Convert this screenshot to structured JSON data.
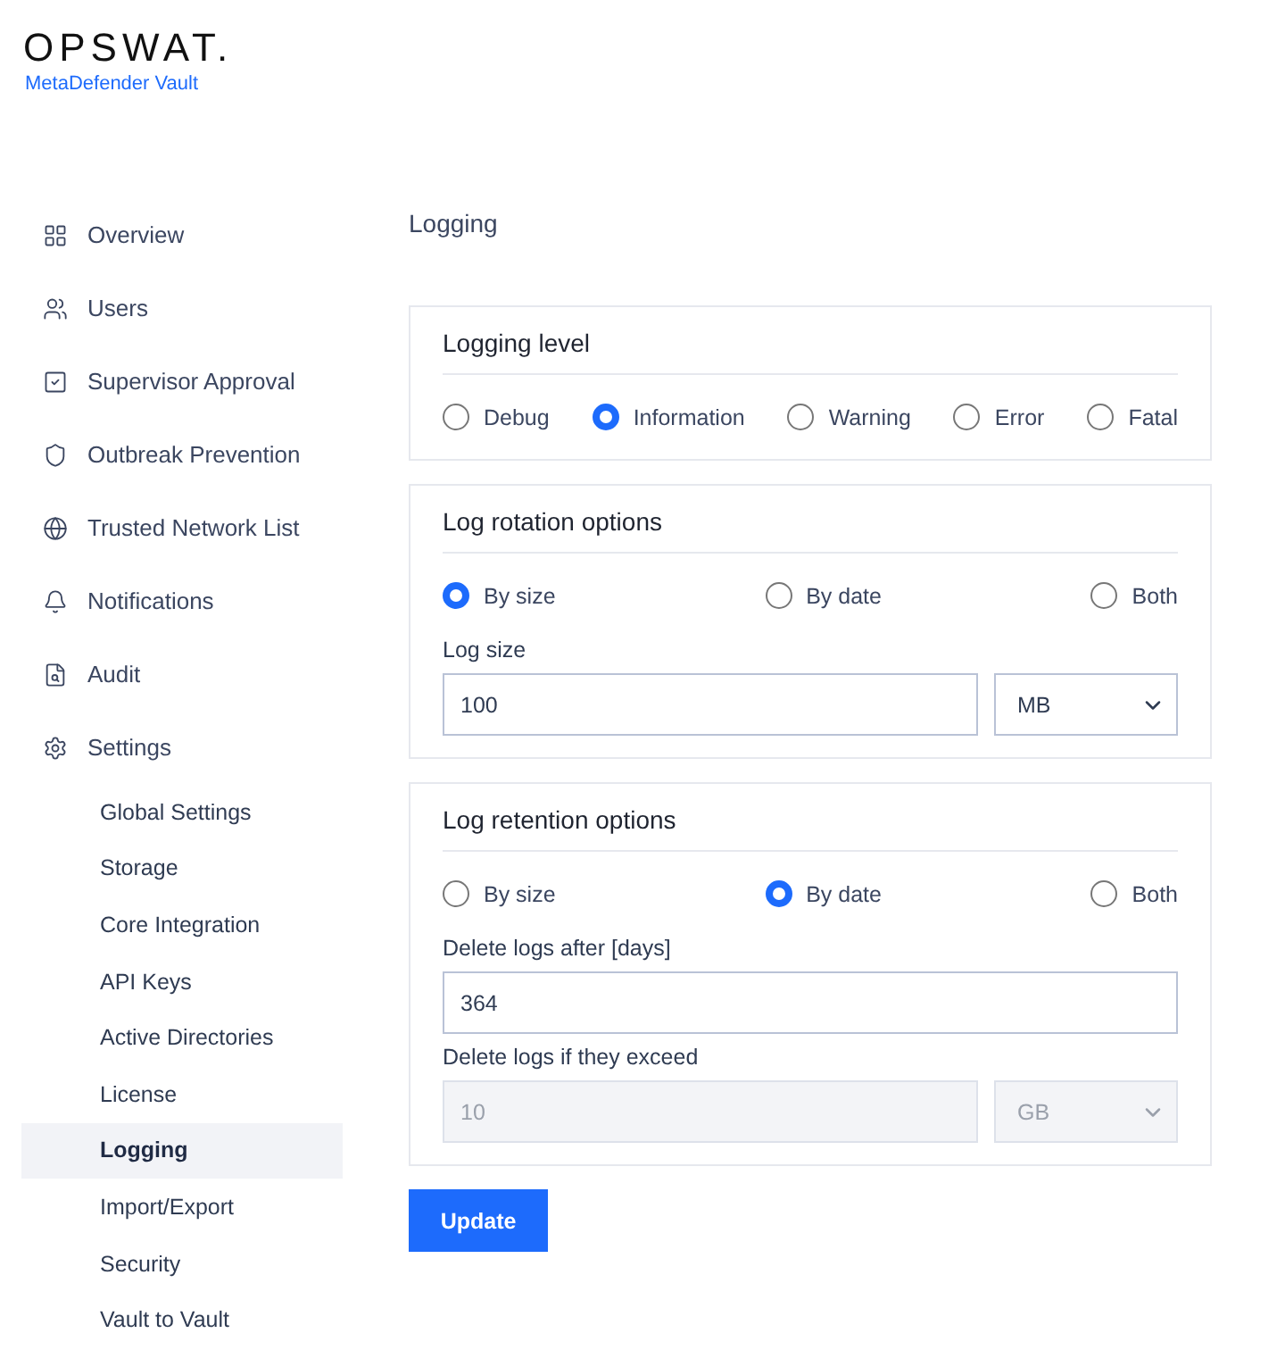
{
  "logo": {
    "brand": "OPSWAT.",
    "product": "MetaDefender Vault"
  },
  "nav": [
    {
      "label": "Overview",
      "selected": false
    },
    {
      "label": "Users",
      "selected": false
    },
    {
      "label": "Supervisor Approval",
      "selected": false
    },
    {
      "label": "Outbreak Prevention",
      "selected": false
    },
    {
      "label": "Trusted Network List",
      "selected": false
    },
    {
      "label": "Notifications",
      "selected": false
    },
    {
      "label": "Audit",
      "selected": false
    },
    {
      "label": "Settings",
      "selected": false,
      "children": [
        {
          "label": "Global Settings",
          "selected": false
        },
        {
          "label": "Storage",
          "selected": false
        },
        {
          "label": "Core Integration",
          "selected": false
        },
        {
          "label": "API Keys",
          "selected": false
        },
        {
          "label": "Active Directories",
          "selected": false
        },
        {
          "label": "License",
          "selected": false
        },
        {
          "label": "Logging",
          "selected": true
        },
        {
          "label": "Import/Export",
          "selected": false
        },
        {
          "label": "Security",
          "selected": false
        },
        {
          "label": "Vault to Vault",
          "selected": false
        }
      ]
    }
  ],
  "page_title": "Logging",
  "sections": [
    {
      "title": "Logging level",
      "kind": "inline",
      "options": [
        {
          "label": "Debug",
          "selected": false
        },
        {
          "label": "Information",
          "selected": true
        },
        {
          "label": "Warning",
          "selected": false
        },
        {
          "label": "Error",
          "selected": false
        },
        {
          "label": "Fatal",
          "selected": false
        }
      ]
    },
    {
      "title": "Log rotation options",
      "kind": "spread",
      "options": [
        {
          "label": "By size",
          "selected": true
        },
        {
          "label": "By date",
          "selected": false
        },
        {
          "label": "Both",
          "selected": false
        }
      ],
      "fields": [
        {
          "label": "Log size",
          "value": "100",
          "unit": "MB",
          "disabled": false
        }
      ]
    },
    {
      "title": "Log retention options",
      "kind": "spread",
      "options": [
        {
          "label": "By size",
          "selected": false
        },
        {
          "label": "By date",
          "selected": true
        },
        {
          "label": "Both",
          "selected": false
        }
      ],
      "fields": [
        {
          "label": "Delete logs after [days]",
          "value": "364",
          "disabled": false
        },
        {
          "label": "Delete logs if they exceed",
          "value": "10",
          "unit": "GB",
          "disabled": true
        }
      ]
    }
  ],
  "button": "Update"
}
